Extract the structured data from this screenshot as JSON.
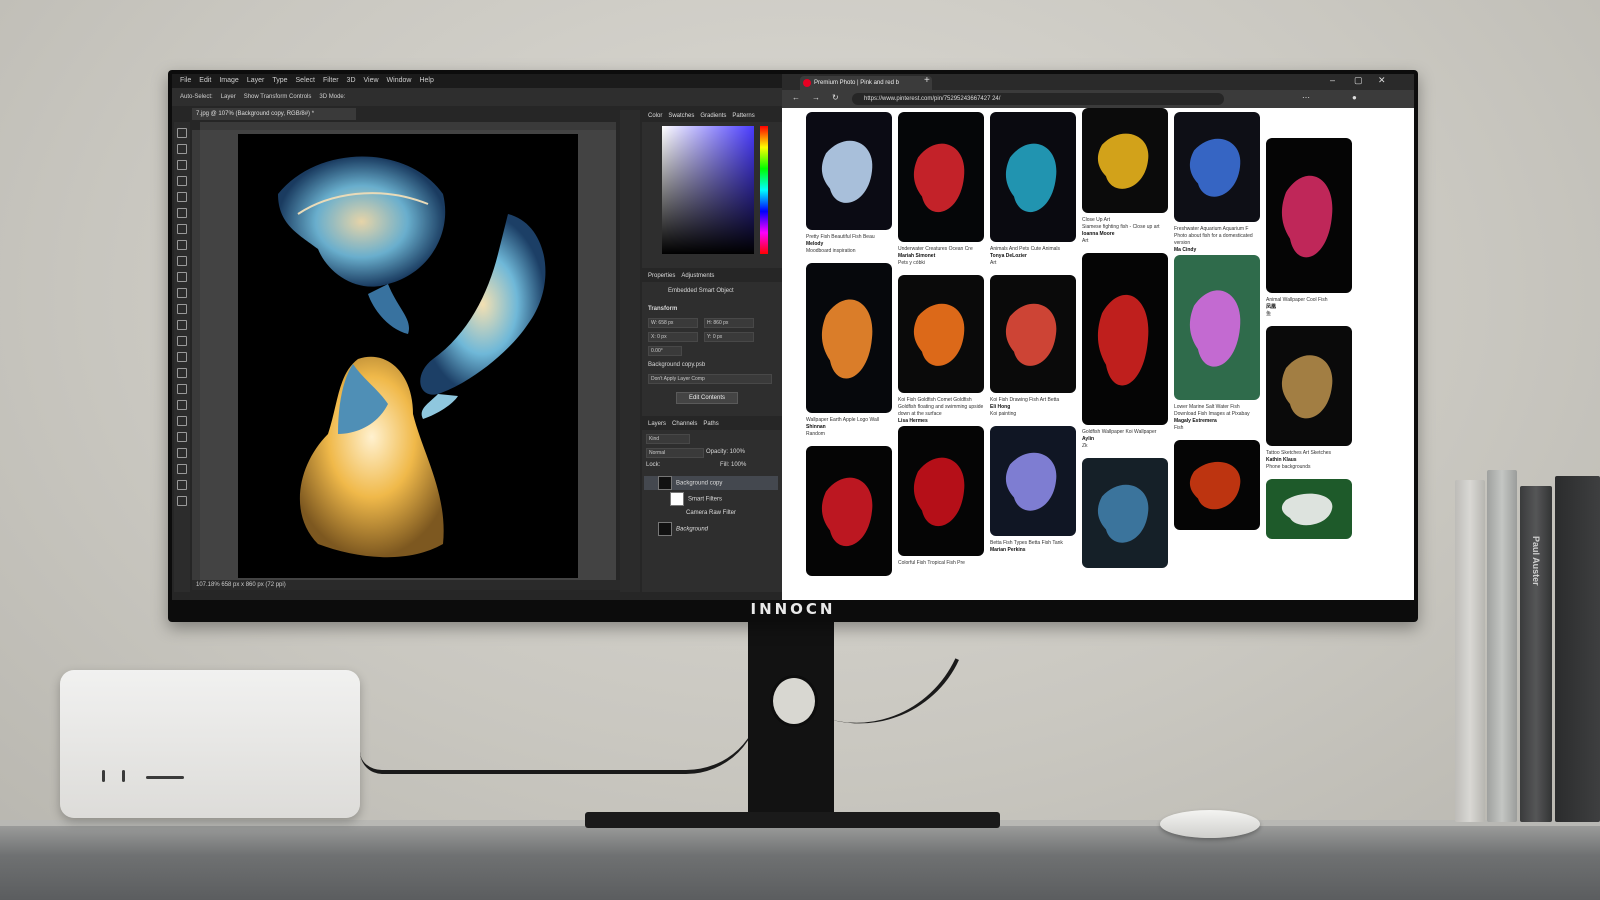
{
  "monitor": {
    "brand": "INNOCN"
  },
  "photoshop": {
    "menu": [
      "File",
      "Edit",
      "Image",
      "Layer",
      "Type",
      "Select",
      "Filter",
      "3D",
      "View",
      "Window",
      "Help"
    ],
    "options": [
      "Auto-Select:",
      "Layer",
      "Show Transform Controls",
      "3D Mode:"
    ],
    "doc_tab": "7.jpg @ 107% (Background copy, RGB/8#) *",
    "status": "107.18%    658 px x 860 px (72 ppi)",
    "color_tabs": [
      "Color",
      "Swatches",
      "Gradients",
      "Patterns"
    ],
    "props_tabs": [
      "Properties",
      "Adjustments"
    ],
    "props": {
      "object": "Embedded Smart Object",
      "transform": "Transform",
      "w": "W: 658 px",
      "h": "H: 860 px",
      "x": "X: 0 px",
      "y": "Y: 0 px",
      "angle": "0.00°",
      "file": "Background copy.psb",
      "comp": "Don't Apply Layer Comp",
      "edit_btn": "Edit Contents"
    },
    "layers_tabs": [
      "Layers",
      "Channels",
      "Paths"
    ],
    "layers_opts": {
      "kind": "Kind",
      "mode": "Normal",
      "opacity": "Opacity: 100%",
      "lock": "Lock:",
      "fill": "Fill: 100%"
    },
    "layers": [
      "Background copy",
      "Smart Filters",
      "Camera Raw Filter",
      "Background"
    ]
  },
  "browser": {
    "tab_title": "Premium Photo | Pink and red b",
    "url": "https://www.pinterest.com/pin/75295243667427 24/",
    "cols": [
      {
        "pins": [
          {
            "h": 118,
            "c": "#0b0b14",
            "fish": "#b9d3ef",
            "meta": [
              "Pretty Fish    Beautiful Fish    Beau"
            ],
            "user": "Melody",
            "sub": "Moodboard inspiration"
          },
          {
            "h": 150,
            "c": "#06080c",
            "fish": "#f28b2c",
            "meta": [
              "Wallpaper Earth    Apple Logo Wall"
            ],
            "user": "Shinnan",
            "sub": "Random"
          },
          {
            "h": 130,
            "c": "#050505",
            "fish": "#d01a25",
            "meta": [],
            "user": "",
            "sub": ""
          }
        ]
      },
      {
        "pins": [
          {
            "h": 130,
            "c": "#050608",
            "fish": "#d8262e",
            "meta": [
              "Underwater Creatures    Ocean Cre"
            ],
            "user": "Mariah Simonet",
            "sub": "Pets y cóbki"
          },
          {
            "h": 118,
            "c": "#0a0a0a",
            "fish": "#f3731b",
            "meta": [
              "Koi Fish Goldfish    Comet Goldfish",
              "Goldfish floating and swimming upside down at the surface"
            ],
            "user": "Lisa Hermes",
            "sub": ""
          },
          {
            "h": 130,
            "c": "#050505",
            "fish": "#c9111b",
            "meta": [
              "Colorful Fish    Tropical Fish    Pre"
            ],
            "user": "",
            "sub": ""
          }
        ]
      },
      {
        "pins": [
          {
            "h": 130,
            "c": "#0a0a10",
            "fish": "#23a3c2",
            "meta": [
              "Animals And Pets    Cute Animals"
            ],
            "user": "Tonya DeLozier",
            "sub": "Art"
          },
          {
            "h": 118,
            "c": "#0a0a0a",
            "fish": "#e24a3a",
            "meta": [
              "Koi Fish Drawing    Fish Art    Betta"
            ],
            "user": "Eli Hong",
            "sub": "Koi painting"
          },
          {
            "h": 110,
            "c": "#101624",
            "fish": "#8b88e6",
            "meta": [
              "Betta Fish Types    Betta Fish Tank"
            ],
            "user": "Marian Perkins",
            "sub": ""
          }
        ]
      },
      {
        "pins": [
          {
            "h": 105,
            "c": "#0b0b0b",
            "fish": "#e8b21c",
            "meta": [
              "Close Up Art",
              "Siamese fighting fish - Close up art"
            ],
            "user": "Ioanna Moore",
            "sub": "Art"
          },
          {
            "h": 172,
            "c": "#050505",
            "fish": "#d42220",
            "meta": [
              "Goldfish Wallpaper    Koi Wallpaper"
            ],
            "user": "Aylin",
            "sub": "Zk"
          },
          {
            "h": 110,
            "c": "#152028",
            "fish": "#3f7da8",
            "meta": [],
            "user": "",
            "sub": ""
          }
        ]
      },
      {
        "pins": [
          {
            "h": 110,
            "c": "#0e0f16",
            "fish": "#3b6fd6",
            "meta": [
              "Freshwater Aquarium    Aquarium F",
              "Photo about fish for a domesticated version"
            ],
            "user": "Ma Cindy",
            "sub": ""
          },
          {
            "h": 145,
            "c": "#2f6b4b",
            "fish": "#d46ae0",
            "meta": [
              "Lower Marine    Salt Water Fish",
              "Download Fish Images at Pixabay"
            ],
            "user": "Magaly Estremera",
            "sub": "Fish"
          },
          {
            "h": 90,
            "c": "#050505",
            "fish": "#d13a12",
            "meta": [],
            "user": "",
            "sub": ""
          }
        ]
      },
      {
        "pins": [
          {
            "h": 155,
            "c": "#050505",
            "fish": "#d42b63",
            "meta": [
              "Animal Wallpaper    Cool Fish"
            ],
            "user": "凤凰",
            "sub": "鱼"
          },
          {
            "h": 120,
            "c": "#0a0a0a",
            "fish": "#b28b49",
            "meta": [
              "Tattoo Sketches    Art Sketches"
            ],
            "user": "Kathin Klaus",
            "sub": "Phone backgrounds"
          },
          {
            "h": 60,
            "c": "#1e5a2a",
            "fish": "#f2f2f2",
            "meta": [],
            "user": "",
            "sub": ""
          }
        ]
      }
    ]
  },
  "colors": {
    "ps_bg": "#262626",
    "accent": "#1473e6",
    "pin_red": "#e60023"
  },
  "book_label": "Paul Auster"
}
